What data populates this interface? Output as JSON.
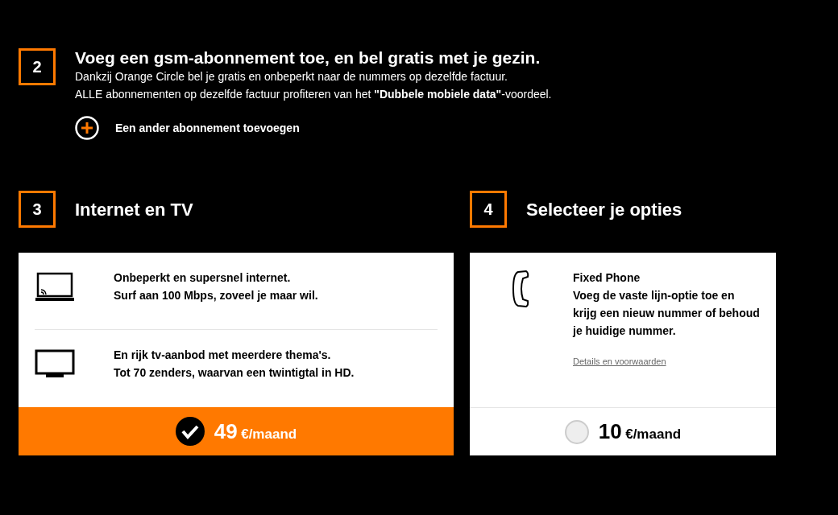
{
  "step_add_mobile": {
    "number": "2",
    "title": "Voeg een gsm-abonnement toe, en bel gratis met je gezin.",
    "lines": [
      "Dankzij Orange Circle bel je gratis en onbeperkt naar de nummers op dezelfde factuur.",
      "ALLE abonnementen op dezelfde factuur profiteren van het **\"Dubbele mobiele data\"**-voordeel."
    ],
    "add_link": "Een ander abonnement toevoegen"
  },
  "sections": [
    {
      "number": "3",
      "title": "Internet en TV",
      "kind": "bundle",
      "features": [
        {
          "kind": "laptop",
          "lines": [
            "Onbeperkt en supersnel internet.",
            "Surf aan 100 Mbps, zoveel je maar wil."
          ]
        },
        {
          "kind": "tv",
          "lines": [
            "En rijk tv-aanbod met meerdere thema's.",
            "Tot 70 zenders, waarvan een twintigtal in HD."
          ]
        }
      ],
      "price": "49",
      "unit": "€/maand",
      "selected": true
    },
    {
      "number": "4",
      "title": "Selecteer je opties",
      "kind": "option",
      "features": [
        {
          "kind": "phone",
          "heading": "Fixed Phone",
          "lines": [
            "Voeg de vaste lijn-optie toe en krijg een nieuw nummer of behoud je huidige nummer."
          ],
          "link": "Details en voorwaarden"
        }
      ],
      "price": "10",
      "unit": "€/maand",
      "selected": false
    }
  ]
}
